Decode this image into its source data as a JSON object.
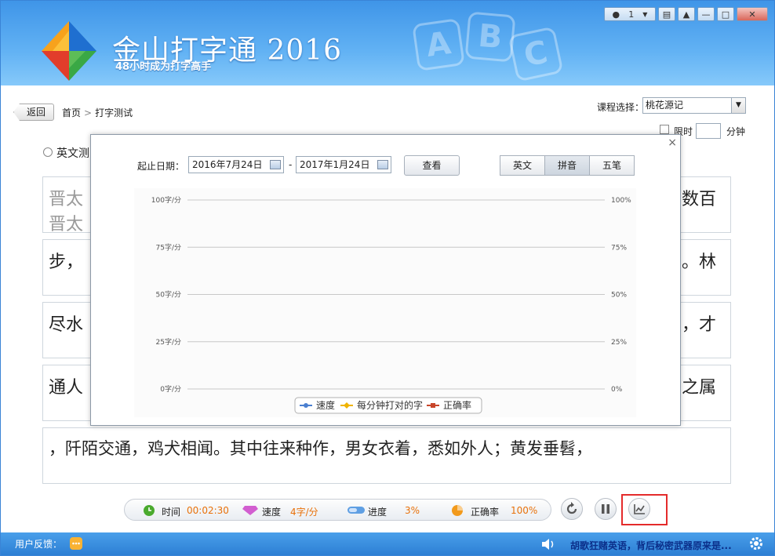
{
  "window": {
    "app_name": "金山打字通 2016",
    "slogan": "48小时成为打字高手",
    "deco_letters": [
      "A",
      "B",
      "C"
    ],
    "user_count": "1",
    "controls": [
      "minimize",
      "maximize",
      "close"
    ]
  },
  "nav": {
    "back_label": "返回",
    "breadcrumb": [
      "首页",
      "打字测试"
    ],
    "breadcrumb_sep": ">"
  },
  "course": {
    "label": "课程选择：",
    "selected": "桃花源记"
  },
  "time_limit": {
    "label": "限时",
    "unit": "分钟",
    "value": ""
  },
  "mode": {
    "label": "英文测"
  },
  "typing_lines": [
    {
      "left": "晋太",
      "right": "数百",
      "left2": "晋太"
    },
    {
      "left": "步，",
      "right": "。林"
    },
    {
      "left": "尽水",
      "right": "，才"
    },
    {
      "left": "通人",
      "right": "之属"
    },
    {
      "full": "，阡陌交通，鸡犬相闻。其中往来种作，男女衣着，悉如外人；黄发垂髫，"
    }
  ],
  "dialog": {
    "date_label": "起止日期：",
    "start_date": "2016年7月24日",
    "end_date": "2017年1月24日",
    "dash": "-",
    "view_button": "查看",
    "tabs": [
      {
        "label": "英文",
        "active": false
      },
      {
        "label": "拼音",
        "active": true
      },
      {
        "label": "五笔",
        "active": false
      }
    ],
    "close_glyph": "×"
  },
  "chart_data": {
    "type": "line",
    "y_left_ticks": [
      "100字/分",
      "75字/分",
      "50字/分",
      "25字/分",
      "0字/分"
    ],
    "y_right_ticks": [
      "100%",
      "75%",
      "50%",
      "25%",
      "0%"
    ],
    "ylim": [
      0,
      100
    ],
    "grid": true,
    "legend_placement": "bottom-center",
    "series": [
      {
        "name": "速度",
        "values": [],
        "color": "#4a7fd0"
      },
      {
        "name": "每分钟打对的字",
        "values": [],
        "color": "#f0b400"
      },
      {
        "name": "正确率",
        "values": [],
        "color": "#c8452a"
      }
    ]
  },
  "status": {
    "time_label": "时间",
    "time_value": "00:02:30",
    "speed_label": "速度",
    "speed_value": "4字/分",
    "progress_label": "进度",
    "progress_value": "3%",
    "accuracy_label": "正确率",
    "accuracy_value": "100%"
  },
  "footer": {
    "feedback_label": "用户反馈：",
    "news_link": "胡歌狂赌英语，背后秘密武器原来是..."
  }
}
